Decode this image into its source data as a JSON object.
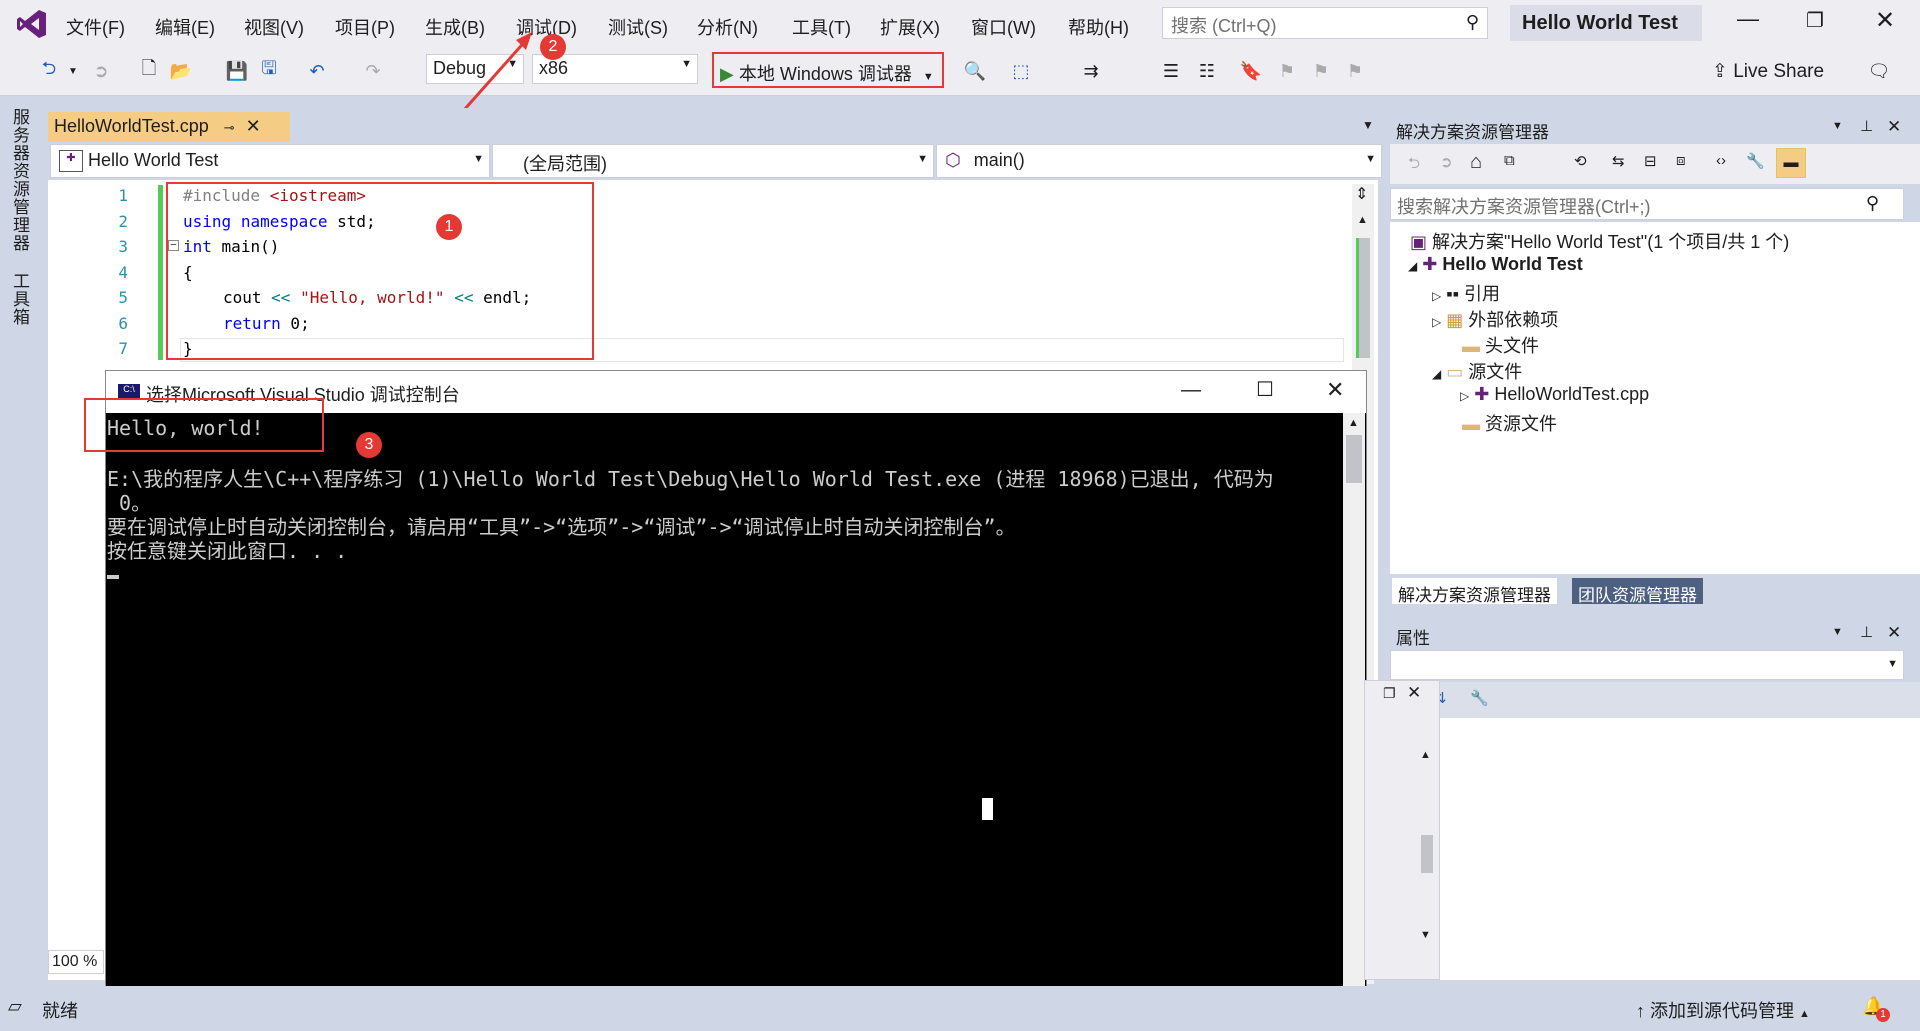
{
  "menu": [
    "文件(F)",
    "编辑(E)",
    "视图(V)",
    "项目(P)",
    "生成(B)",
    "调试(D)",
    "测试(S)",
    "分析(N)",
    "工具(T)",
    "扩展(X)",
    "窗口(W)",
    "帮助(H)"
  ],
  "search_placeholder": "搜索 (Ctrl+Q)",
  "solution_title": "Hello World Test",
  "toolbar": {
    "config": "Debug",
    "platform": "x86",
    "run_label": "本地 Windows 调试器",
    "live_share": "Live Share"
  },
  "side_tabs": [
    "服务器资源管理器",
    "工具箱"
  ],
  "editor": {
    "tab_label": "HelloWorldTest.cpp",
    "nav_project": "Hello World Test",
    "nav_scope": "(全局范围)",
    "nav_member": "main()",
    "line_numbers": [
      "1",
      "2",
      "3",
      "4",
      "5",
      "6",
      "7"
    ],
    "zoom": "100 %"
  },
  "code": {
    "l1_pp": "#include",
    "l1_inc": "<iostream>",
    "l2_kw1": "using",
    "l2_kw2": "namespace",
    "l2_rest": "std;",
    "l3_kw": "int",
    "l3_rest": "main()",
    "l4": "{",
    "l5_a": "cout ",
    "l5_op1": "<<",
    "l5_str": " \"Hello, world!\" ",
    "l5_op2": "<<",
    "l5_b": " endl;",
    "l6_kw": "return",
    "l6_rest": " 0;",
    "l7": "}"
  },
  "badges": [
    "1",
    "2",
    "3"
  ],
  "console": {
    "title": "选择Microsoft Visual Studio 调试控制台",
    "line1": "Hello, world!",
    "line2": "E:\\我的程序人生\\C++\\程序练习 (1)\\Hello World Test\\Debug\\Hello World Test.exe (进程 18968)已退出, 代码为",
    "line3": " 0。",
    "line4": "要在调试停止时自动关闭控制台，请启用“工具”->“选项”->“调试”->“调试停止时自动关闭控制台”。",
    "line5": "按任意键关闭此窗口. . ."
  },
  "solution_explorer": {
    "title": "解决方案资源管理器",
    "search_placeholder": "搜索解决方案资源管理器(Ctrl+;)",
    "items": [
      "解决方案\"Hello World Test\"(1 个项目/共 1 个)",
      "Hello World Test",
      "引用",
      "外部依赖项",
      "头文件",
      "源文件",
      "HelloWorldTest.cpp",
      "资源文件"
    ],
    "tabs": [
      "解决方案资源管理器",
      "团队资源管理器"
    ]
  },
  "properties": {
    "title": "属性"
  },
  "status": {
    "ready": "就绪",
    "source_control": "添加到源代码管理",
    "notify_count": "1"
  }
}
